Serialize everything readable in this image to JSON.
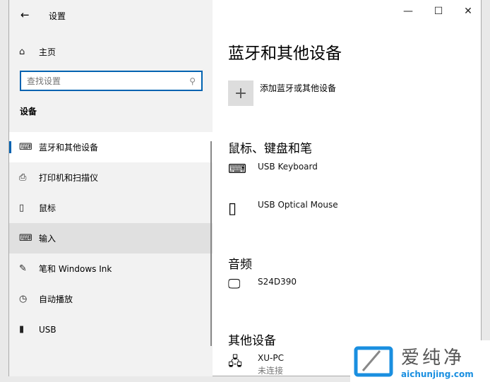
{
  "window": {
    "title": "设置",
    "back_icon": "arrow-left-icon",
    "minimize": "—",
    "maximize": "☐",
    "close": "✕"
  },
  "sidebar": {
    "home": "主页",
    "search_placeholder": "查找设置",
    "section": "设备",
    "items": [
      {
        "label": "蓝牙和其他设备",
        "icon": "bluetooth-devices-icon"
      },
      {
        "label": "打印机和扫描仪",
        "icon": "printer-icon"
      },
      {
        "label": "鼠标",
        "icon": "mouse-icon"
      },
      {
        "label": "输入",
        "icon": "keyboard-icon"
      },
      {
        "label": "笔和 Windows Ink",
        "icon": "pen-icon"
      },
      {
        "label": "自动播放",
        "icon": "autoplay-icon"
      },
      {
        "label": "USB",
        "icon": "usb-icon"
      }
    ]
  },
  "main": {
    "title": "蓝牙和其他设备",
    "add_label": "添加蓝牙或其他设备",
    "sections": [
      {
        "title": "鼠标、键盘和笔",
        "devices": [
          {
            "name": "USB Keyboard"
          },
          {
            "name": "USB Optical Mouse"
          }
        ]
      },
      {
        "title": "音频",
        "devices": [
          {
            "name": "S24D390"
          }
        ]
      },
      {
        "title": "其他设备",
        "devices": [
          {
            "name": "XU-PC",
            "status": "未连接"
          }
        ]
      }
    ]
  },
  "watermark": {
    "brand": "爱纯净",
    "url": "aichunjing.com"
  },
  "colors": {
    "accent": "#0063b1"
  }
}
